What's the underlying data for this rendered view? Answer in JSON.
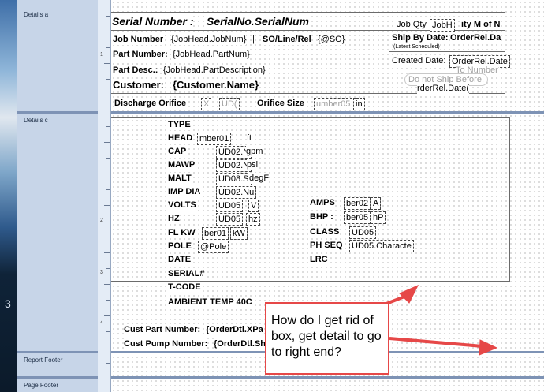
{
  "sections": {
    "details_a": "Details a",
    "details_c": "Details c",
    "report_footer": "Report Footer",
    "page_footer": "Page Footer"
  },
  "ruler_numbers": [
    "1",
    "2",
    "3",
    "4"
  ],
  "desktop_digit": "3",
  "header": {
    "serial_label": "Serial Number :",
    "serial_value": "SerialNo.SerialNum",
    "job_qty_label": "Job Qty",
    "job_qty_value": "JobH",
    "qty_of_n": "ity M of N",
    "job_number_label": "Job Number",
    "job_number_value": "{JobHead.JobNum}",
    "pipe": "|",
    "so_line_label": "SO/Line/Rel",
    "so_value": "{@SO}",
    "part_number_label": "Part Number:",
    "part_number_value": "{JobHead.PartNum}",
    "part_desc_label": "Part Desc.:",
    "part_desc_value": "{JobHead.PartDescription}",
    "customer_label": "Customer:",
    "customer_value": "{Customer.Name}",
    "ship_by_label": "Ship By Date:",
    "ship_by_value": "OrderRel.Da",
    "latest_scheduled": "(Latest Scheduled)",
    "created_label": "Created Date:",
    "created_value": "OrderRel.Date",
    "to_number": "To Number",
    "do_not_ship": "Do not Ship Before!",
    "order_rel_date": "rderRel.Date(",
    "discharge_label": "Discharge Orifice",
    "discharge_x": "X",
    "discharge_ud": "UD(",
    "orifice_size_label": "Orifice Size",
    "orifice_value": "umber05",
    "orifice_unit": "in"
  },
  "specs_left": [
    {
      "label": "TYPE",
      "value": "",
      "unit": ""
    },
    {
      "label": "HEAD",
      "value": "mber01",
      "unit": "ft"
    },
    {
      "label": "CAP",
      "value": "UD02.N",
      "unit": "gpm"
    },
    {
      "label": "MAWP",
      "value": "UD02.N",
      "unit": "psi"
    },
    {
      "label": "MALT",
      "value": "UD08.S",
      "unit": "degF"
    },
    {
      "label": "IMP DIA",
      "value": "UD02.Nu",
      "unit": ""
    },
    {
      "label": "VOLTS",
      "value": "UD05",
      "unit": "V"
    },
    {
      "label": "HZ",
      "value": "UD05",
      "unit": "hz"
    },
    {
      "label": "FL KW",
      "value": "ber01",
      "unit": "kW"
    },
    {
      "label": "POLE",
      "value": "@Pole",
      "unit": ""
    },
    {
      "label": "DATE",
      "value": "",
      "unit": ""
    },
    {
      "label": "SERIAL#",
      "value": "",
      "unit": ""
    },
    {
      "label": "T-CODE",
      "value": "",
      "unit": ""
    },
    {
      "label": "AMBIENT TEMP 40C",
      "value": "",
      "unit": ""
    }
  ],
  "specs_right": [
    {
      "label": "AMPS",
      "value": "ber02",
      "unit": "A"
    },
    {
      "label": "BHP :",
      "value": "ber05",
      "unit": "hP"
    },
    {
      "label": "CLASS",
      "value": "UD05",
      "unit": ""
    },
    {
      "label": "PH SEQ",
      "value": "UD05.Characte",
      "unit": ""
    },
    {
      "label": "LRC",
      "value": "",
      "unit": ""
    }
  ],
  "cust": {
    "part_label": "Cust Part Number:",
    "part_value": "{OrderDtl.XPa",
    "pump_label": "Cust Pump Number:",
    "pump_value": "{OrderDtl.Sh"
  },
  "callout": {
    "text": "How do I get rid of box, get detail to go to right end?"
  },
  "colors": {
    "callout_border": "#e64848",
    "arrow": "#e64848"
  }
}
